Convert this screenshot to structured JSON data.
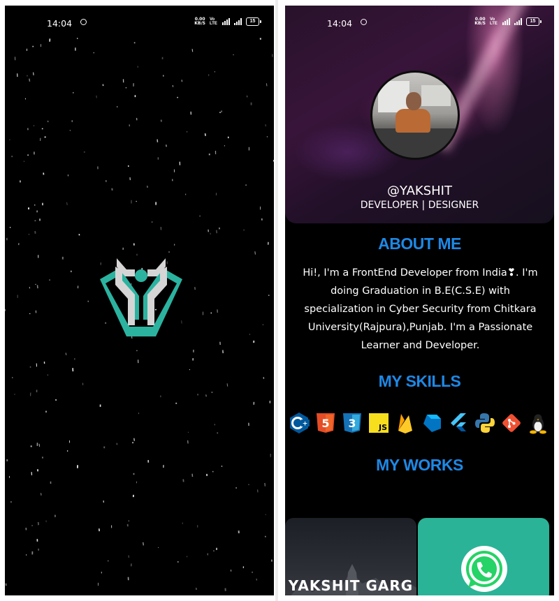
{
  "status_bar": {
    "time": "14:04",
    "net_speed_top": "0.00",
    "net_speed_unit": "KB/S",
    "volte": "Vo LTE",
    "battery": "15"
  },
  "splash": {
    "logo_icon": "yakshit-logo-icon",
    "logo_color": "#2bb3a0"
  },
  "profile": {
    "handle": "@YAKSHIT",
    "roles": "DEVELOPER | DESIGNER"
  },
  "about": {
    "title": "ABOUT ME",
    "text": "Hi!, I'm a FrontEnd Developer from India❣. I'm doing Graduation in B.E(C.S.E) with specialization in Cyber Security from Chitkara University(Rajpura),Punjab. I'm a Passionate Learner and Developer."
  },
  "skills": {
    "title": "MY SKILLS",
    "items": [
      "cpp-icon",
      "html5-icon",
      "css3-icon",
      "javascript-icon",
      "firebase-icon",
      "dart-icon",
      "flutter-icon",
      "python-icon",
      "git-icon",
      "linux-icon"
    ],
    "js_label": "JS"
  },
  "works": {
    "title": "MY WORKS",
    "cards": [
      {
        "title": "YAKSHIT GARG",
        "icon": "portfolio-thumbnail"
      },
      {
        "title": "",
        "icon": "whatsapp-icon"
      }
    ]
  },
  "colors": {
    "accent": "#1e88e5",
    "background": "#000000",
    "logo_teal": "#2bb3a0"
  }
}
